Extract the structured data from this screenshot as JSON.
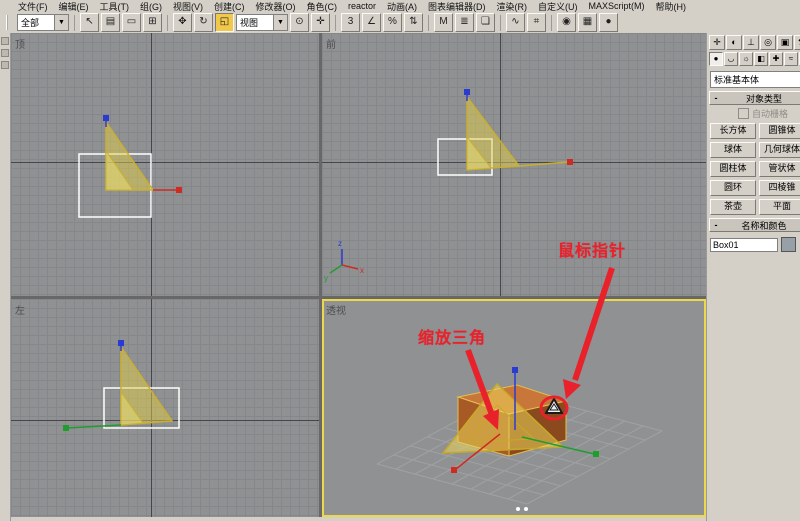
{
  "menubar": {
    "items": [
      "文件(F)",
      "编辑(E)",
      "工具(T)",
      "组(G)",
      "视图(V)",
      "创建(C)",
      "修改器(O)",
      "角色(C)",
      "reactor",
      "动画(A)",
      "图表编辑器(D)",
      "渲染(R)",
      "自定义(U)",
      "MAXScript(M)",
      "帮助(H)"
    ]
  },
  "toolbar": {
    "filter_value": "全部",
    "coord_value": "视图",
    "icons": [
      {
        "glyph": "↖"
      },
      {
        "glyph": "▤"
      },
      {
        "glyph": "▭"
      },
      {
        "glyph": "⊞"
      },
      {
        "glyph": "✥"
      },
      {
        "glyph": "↻"
      },
      {
        "glyph": "◱"
      },
      {
        "glyph": "⊙"
      },
      {
        "glyph": "✛"
      },
      {
        "glyph": "3"
      },
      {
        "glyph": "∠"
      },
      {
        "glyph": "%"
      },
      {
        "glyph": "⇅"
      },
      {
        "glyph": "M"
      },
      {
        "glyph": "≣"
      },
      {
        "glyph": "❏"
      },
      {
        "glyph": "∿"
      },
      {
        "glyph": "⌗"
      },
      {
        "glyph": "◉"
      },
      {
        "glyph": "▦"
      },
      {
        "glyph": "●"
      }
    ]
  },
  "viewports": {
    "top_left": {
      "label": "顶"
    },
    "top_right": {
      "label": "前",
      "tripod": {
        "x": "x",
        "y": "y",
        "z": "z"
      }
    },
    "bottom_left": {
      "label": "左"
    },
    "perspective": {
      "label": "透视"
    }
  },
  "panel": {
    "tabs": [
      {
        "glyph": "✛"
      },
      {
        "glyph": "◐"
      },
      {
        "glyph": "⊥"
      },
      {
        "glyph": "◎"
      },
      {
        "glyph": "▣"
      },
      {
        "glyph": "⚒"
      }
    ],
    "cats": [
      {
        "glyph": "●"
      },
      {
        "glyph": "◡"
      },
      {
        "glyph": "☼"
      },
      {
        "glyph": "◧"
      },
      {
        "glyph": "✚"
      },
      {
        "glyph": "≈"
      },
      {
        "glyph": "⚙"
      }
    ],
    "primitive_dropdown": "标准基本体",
    "collapse": "-",
    "rollouts": {
      "object_type": "对象类型",
      "name_color": "名称和颜色"
    },
    "autogrid": "自动栅格",
    "buttons": [
      "长方体",
      "圆锥体",
      "球体",
      "几何球体",
      "圆柱体",
      "管状体",
      "圆环",
      "四棱锥",
      "茶壶",
      "平面"
    ],
    "name_value": "Box01"
  },
  "annotations": {
    "scale_triangle": "缩放三角",
    "mouse_pointer": "鼠标指针"
  },
  "colors": {
    "active_viewport_border": "#ecd84a",
    "annotation_red": "#e8212a",
    "gizmo_yellow": "#caaf2e",
    "axis_red": "#cf2b20",
    "axis_green": "#1f9e2e",
    "axis_blue": "#2b3bd0"
  }
}
